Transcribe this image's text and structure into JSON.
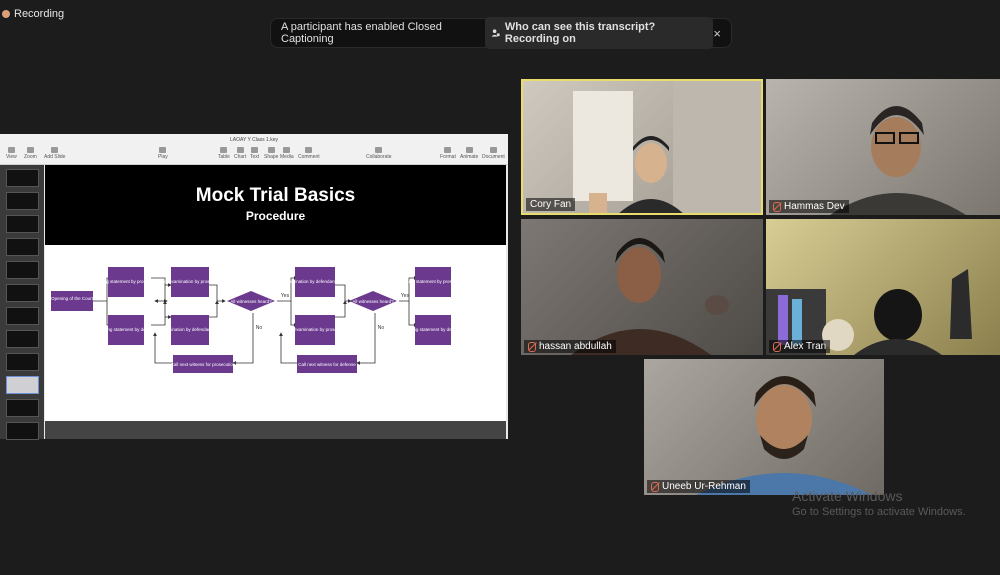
{
  "recording_label": "Recording",
  "caption_banner": {
    "message": "A participant has enabled Closed Captioning",
    "who_label": "Who can see this transcript? Recording on",
    "close_glyph": "×"
  },
  "shared_screen": {
    "window_title": "LAOAY Y Class 1.key",
    "toolbar": [
      "View",
      "Zoom",
      "Add Slide",
      "Play",
      "Table",
      "Chart",
      "Text",
      "Shape",
      "Media",
      "Comment",
      "Collaborate",
      "Format",
      "Animate",
      "Document"
    ],
    "slide": {
      "title": "Mock Trial Basics",
      "subtitle": "Procedure",
      "flowchart": {
        "start": "Opening of the Court",
        "opening_prosecution": "Opening statement by prosecution",
        "opening_defense": "Opening statement by defense",
        "direct_prosecution": "Direct examination by prosecution",
        "cross_defense": "Cross examination by defendants' attorney",
        "decision1": "All witnesses heard?",
        "call_next1": "Call next witness for prosecution",
        "direct_defense": "Direct examination by defendants' attorneys",
        "cross_prosecution": "Cross examination by prosecution",
        "decision2": "All witnesses heard?",
        "call_next2": "Call next witness for defense",
        "closing_prosecution": "Closing statement by prosecution",
        "closing_defense": "Closing statement by defense",
        "yes": "Yes",
        "no": "No"
      }
    }
  },
  "participants": [
    {
      "name": "Cory Fan",
      "active": true
    },
    {
      "name": "Hammas Dev",
      "muted": true
    },
    {
      "name": "hassan abdullah",
      "muted": true
    },
    {
      "name": "Alex Tran",
      "muted": true
    },
    {
      "name": "Uneeb Ur-Rehman",
      "muted": true
    }
  ],
  "watermark": {
    "line1": "Activate Windows",
    "line2": "Go to Settings to activate Windows."
  },
  "colors": {
    "flow_box": "#6b3a8e",
    "active_speaker": "#e8dc6a",
    "background": "#1c1c1c"
  }
}
